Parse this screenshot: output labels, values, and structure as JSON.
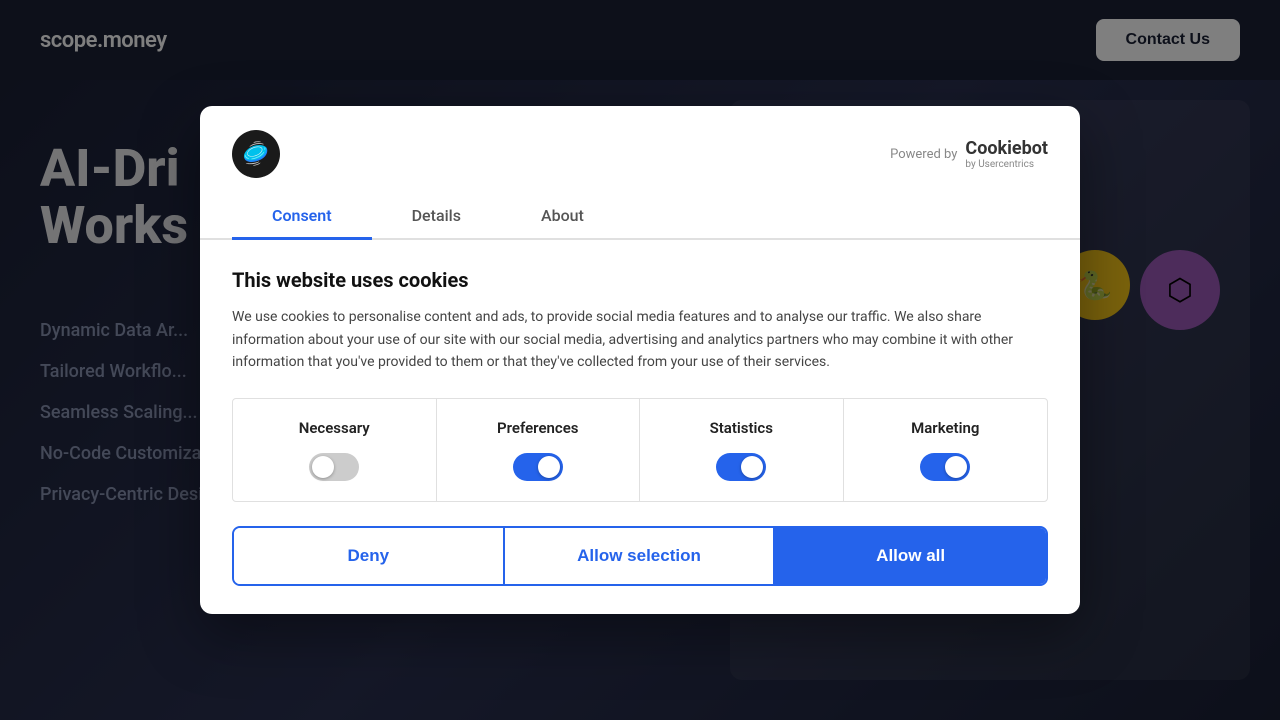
{
  "header": {
    "logo": "scope.money",
    "contact_btn": "Contact Us"
  },
  "hero": {
    "title_line1": "AI-Dri",
    "title_line2": "Works",
    "features": [
      "Dynamic Data Ar...",
      "Tailored Workflo...",
      "Seamless Scaling...",
      "No-Code Customization",
      "Privacy-Centric Design"
    ]
  },
  "cookie_modal": {
    "powered_by_label": "Powered by",
    "cookiebot_name": "Cookiebot",
    "cookiebot_sub": "by Usercentrics",
    "tabs": [
      {
        "id": "consent",
        "label": "Consent",
        "active": true
      },
      {
        "id": "details",
        "label": "Details",
        "active": false
      },
      {
        "id": "about",
        "label": "About",
        "active": false
      }
    ],
    "title": "This website uses cookies",
    "description": "We use cookies to personalise content and ads, to provide social media features and to analyse our traffic. We also share information about your use of our site with our social media, advertising and analytics partners who may combine it with other information that you've provided to them or that they've collected from your use of their services.",
    "categories": [
      {
        "id": "necessary",
        "label": "Necessary",
        "enabled": false,
        "locked": true
      },
      {
        "id": "preferences",
        "label": "Preferences",
        "enabled": true,
        "locked": false
      },
      {
        "id": "statistics",
        "label": "Statistics",
        "enabled": true,
        "locked": false
      },
      {
        "id": "marketing",
        "label": "Marketing",
        "enabled": true,
        "locked": false
      }
    ],
    "buttons": {
      "deny": "Deny",
      "allow_selection": "Allow selection",
      "allow_all": "Allow all"
    }
  },
  "colors": {
    "accent": "#2563eb",
    "bg_dark": "#1a2035"
  }
}
